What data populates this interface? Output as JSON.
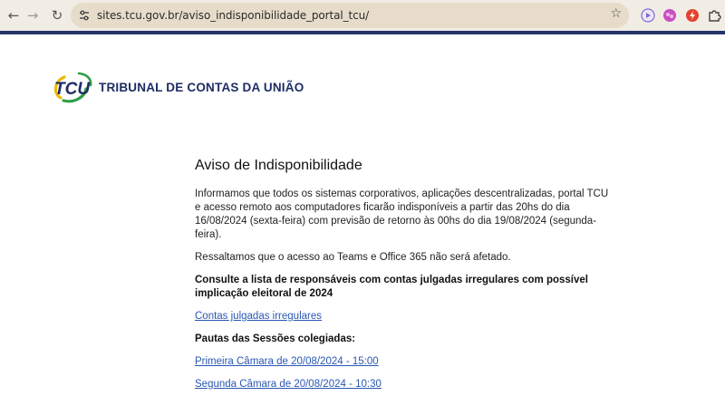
{
  "browser": {
    "url": "sites.tcu.gov.br/aviso_indisponibilidade_portal_tcu/",
    "icons": {
      "back": "arrow-left-icon",
      "forward": "arrow-right-icon",
      "reload": "reload-icon",
      "site_info": "tune-icon",
      "bookmark": "star-icon"
    },
    "accent_color": "#23346b"
  },
  "header": {
    "logo_text": "TCU",
    "org_name": "TRIBUNAL DE CONTAS DA UNIÃO"
  },
  "notice": {
    "title": "Aviso de Indisponibilidade",
    "paragraph1": "Informamos que todos os sistemas corporativos, aplicações descentralizadas, portal TCU e acesso remoto aos computadores ficarão indisponíveis a partir das 20hs do dia 16/08/2024 (sexta-feira) com previsão de retorno às 00hs do dia 19/08/2024 (segunda-feira).",
    "paragraph2": "Ressaltamos que o acesso ao Teams e Office 365 não será afetado.",
    "list_heading": "Consulte a lista de responsáveis com contas julgadas irregulares com possível implicação eleitoral de 2024",
    "link_contas": "Contas julgadas irregulares",
    "sessions_heading": "Pautas das Sessões colegiadas:",
    "link_primeira": "Primeira Câmara de 20/08/2024 - 15:00",
    "link_segunda": "Segunda Câmara de 20/08/2024 - 10:30"
  }
}
